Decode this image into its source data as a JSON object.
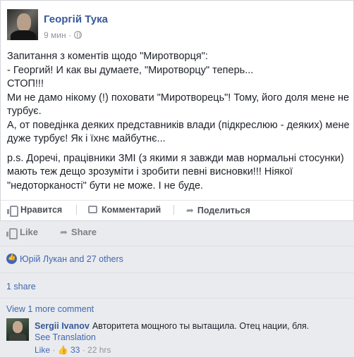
{
  "post": {
    "author": "Георгій Тука",
    "time": "9 мин",
    "paragraphs": [
      "Запитання з коментів щодо \"Миротворця\":\n- Георгий! И как вы думаете, \"Миротворцу\" теперь...\nСТОП!!!\nМи не дамо нікому (!) поховати \"Миротворець\"! Тому, його доля мене не турбує.\nА, от поведінка деяких представників влади (підкреслюю - деяких) мене дуже турбує! Як і їхнє майбутнє...",
      "p.s. Доречі, працівники ЗМІ (з якими я завжди мав нормальні стосунки) мають теж дещо зрозуміти і зробити певні висновки!!! Ніякої \"недоторканості\" бути не може. І не буде."
    ],
    "actions": {
      "like": "Нравится",
      "comment": "Комментарий",
      "share": "Поделиться"
    }
  },
  "outer_actions": {
    "like": "Like",
    "share": "Share"
  },
  "reactions": {
    "text": "Юрій Лукан and 27 others"
  },
  "shares": "1 share",
  "view_more_comments": "View 1 more comment",
  "comment": {
    "author": "Sergii Ivanov",
    "text": "Авторитета мощного ты вытащила. Отец нации, бля.",
    "see_translation": "See Translation",
    "like_label": "Like",
    "like_count": "33",
    "time": "22 hrs"
  }
}
